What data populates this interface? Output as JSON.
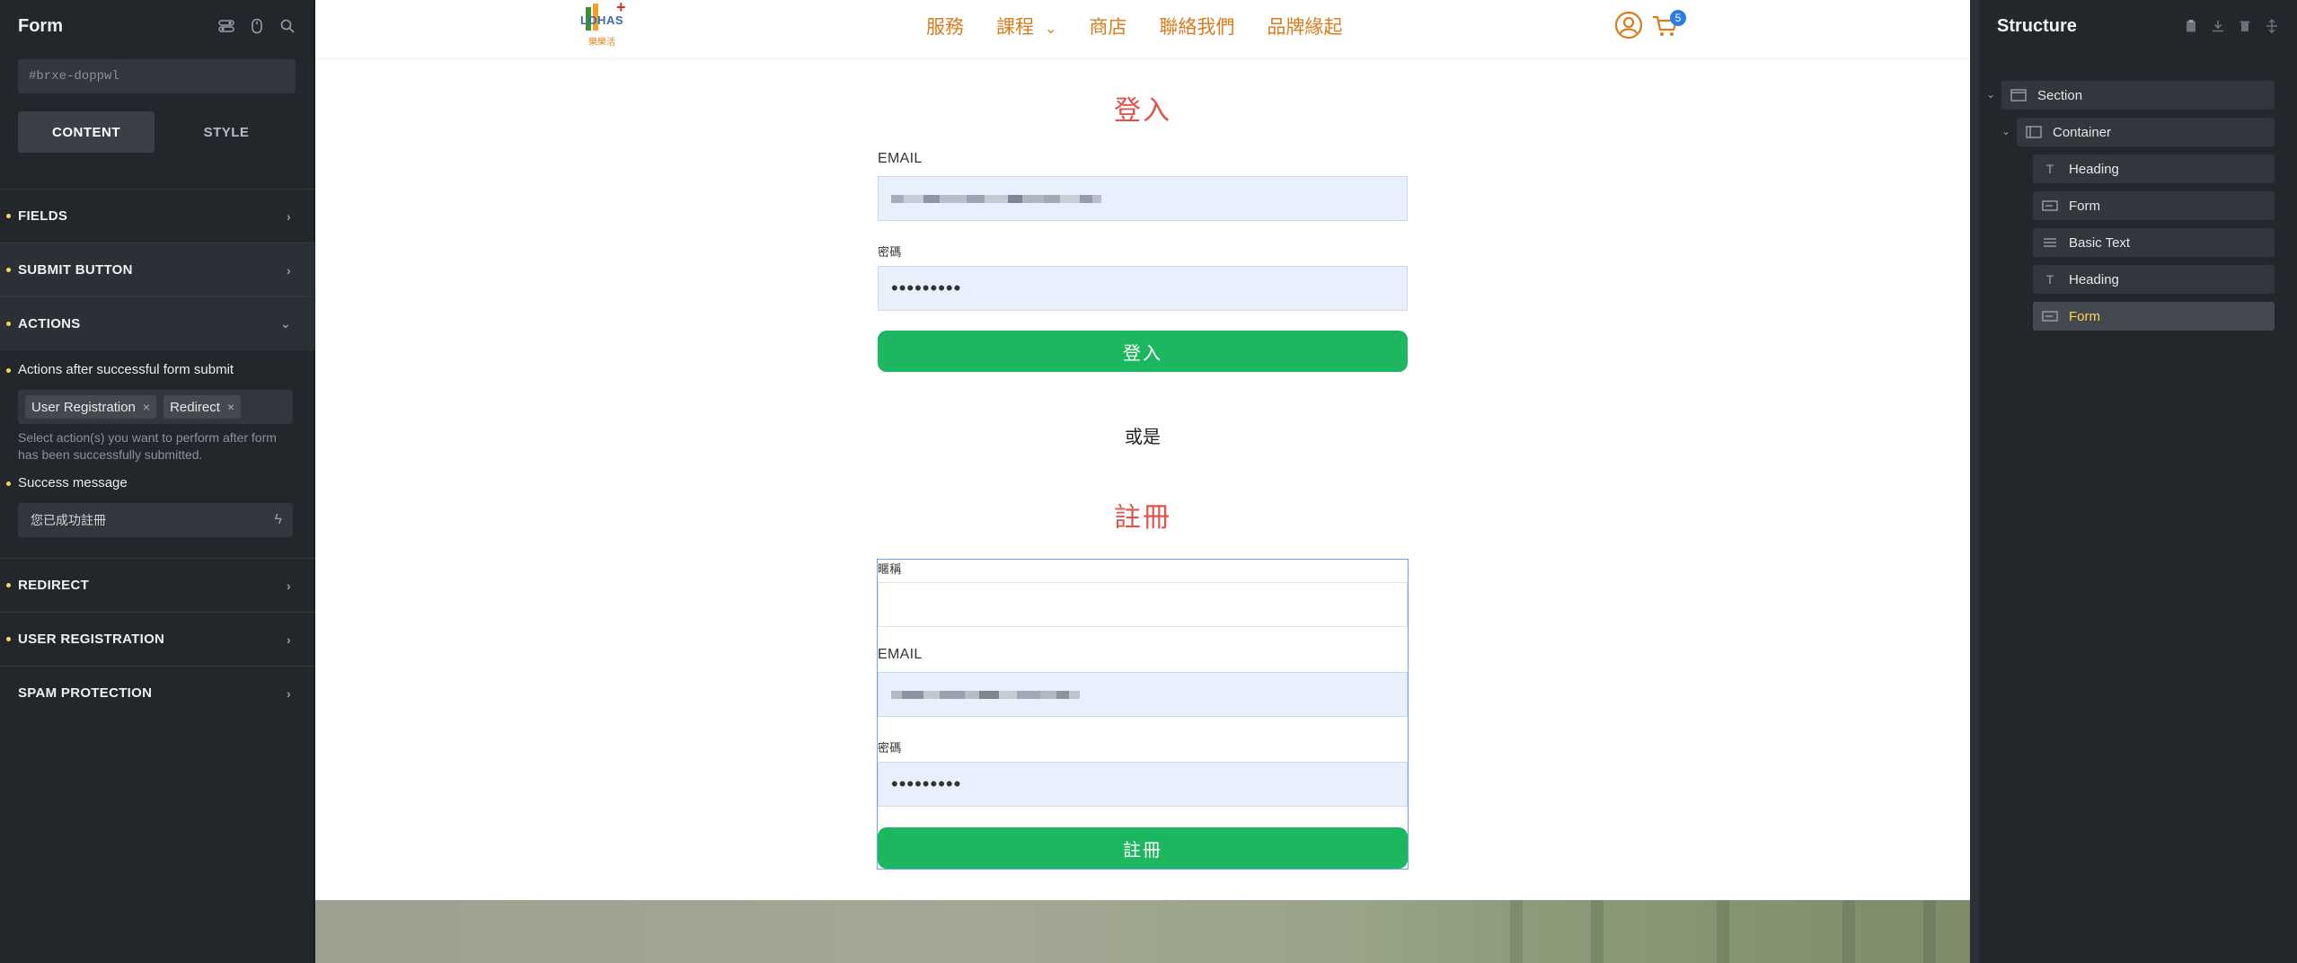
{
  "left_panel": {
    "title": "Form",
    "element_id": "#brxe-doppwl",
    "tabs": {
      "content": "CONTENT",
      "style": "STYLE"
    },
    "sections": {
      "fields": "FIELDS",
      "submit_button": "SUBMIT BUTTON",
      "actions": "ACTIONS",
      "redirect": "REDIRECT",
      "user_registration": "USER REGISTRATION",
      "spam_protection": "SPAM PROTECTION"
    },
    "actions": {
      "label": "Actions after successful form submit",
      "tags": [
        "User Registration",
        "Redirect"
      ],
      "help": "Select action(s) you want to perform after form has been successfully submitted.",
      "success_label": "Success message",
      "success_value": "您已成功註冊"
    },
    "accent": "#ffd64f"
  },
  "site": {
    "logo_text": "LOHAS",
    "logo_sub": "樂樂活",
    "menu": [
      "服務",
      "課程",
      "商店",
      "聯絡我們",
      "品牌緣起"
    ],
    "cart_count": "5",
    "accent_orange": "#d97c1e"
  },
  "login": {
    "heading": "登入",
    "email_label": "EMAIL",
    "password_label": "密碼",
    "password_value": "•••••••••",
    "button": "登入"
  },
  "or_text": "或是",
  "register": {
    "heading": "註冊",
    "nickname_label": "暱稱",
    "email_label": "EMAIL",
    "password_label": "密碼",
    "password_value": "•••••••••",
    "button": "註冊",
    "button_color": "#1db760"
  },
  "structure": {
    "title": "Structure",
    "nodes": [
      {
        "label": "Section",
        "icon": "section-icon"
      },
      {
        "label": "Container",
        "icon": "container-icon"
      },
      {
        "label": "Heading",
        "icon": "heading-icon"
      },
      {
        "label": "Form",
        "icon": "form-icon"
      },
      {
        "label": "Basic Text",
        "icon": "text-icon"
      },
      {
        "label": "Heading",
        "icon": "heading-icon"
      },
      {
        "label": "Form",
        "icon": "form-icon"
      }
    ]
  }
}
